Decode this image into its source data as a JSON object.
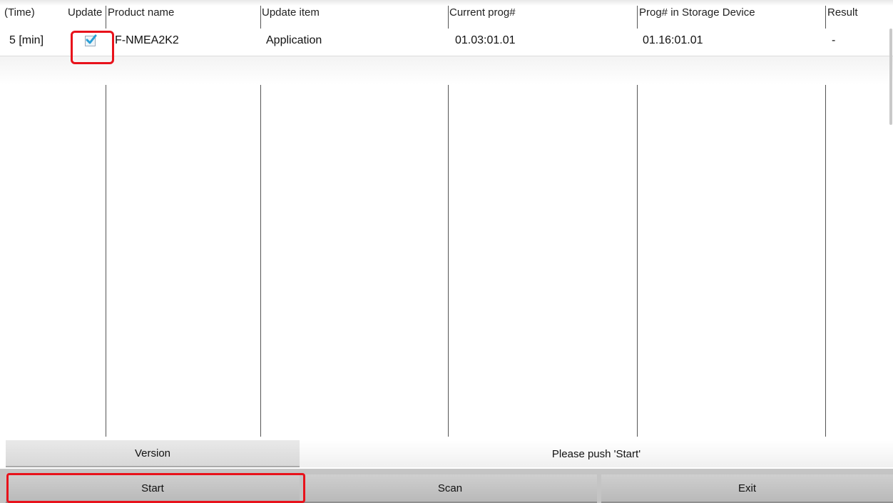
{
  "table": {
    "headers": {
      "time": "(Time)",
      "update": "Update",
      "product_name": "Product name",
      "update_item": "Update item",
      "current_prog": "Current prog#",
      "storage_prog": "Prog# in Storage Device",
      "result": "Result"
    },
    "rows": [
      {
        "time": "5 [min]",
        "update_checked": true,
        "product_name": "F-NMEA2K2",
        "update_item": "Application",
        "current_prog": "01.03:01.01",
        "storage_prog": "01.16:01.01",
        "result": "-"
      }
    ]
  },
  "controls": {
    "version_label": "Version",
    "status_text": "Please push 'Start'",
    "start_label": "Start",
    "scan_label": "Scan",
    "exit_label": "Exit"
  },
  "icons": {
    "checkbox": "checkmark-icon"
  },
  "colors": {
    "highlight": "#e8121b",
    "check_accent": "#2a9fd6"
  }
}
